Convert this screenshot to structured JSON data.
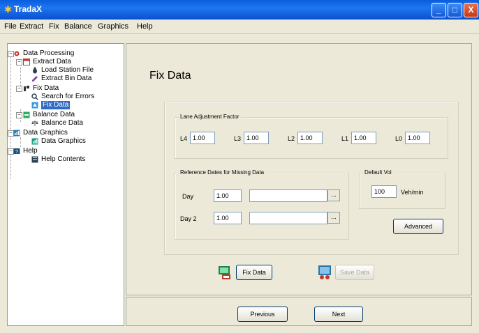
{
  "window": {
    "title": "TradaX",
    "buttons": {
      "minimize": "_",
      "maximize": "□",
      "close": "X"
    }
  },
  "menu": [
    "File",
    "Extract",
    "Fix",
    "Balance",
    "Graphics",
    "Help"
  ],
  "tree": {
    "root": "Data Processing",
    "extract_data": "Extract Data",
    "load_station_file": "Load Station File",
    "extract_bin_data": "Extract Bin Data",
    "fix_data": "Fix Data",
    "search_errors": "Search for Errors",
    "fix_data_child": "Fix Data",
    "balance_data": "Balance Data",
    "balance_data_child": "Balance Data",
    "data_graphics": "Data Graphics",
    "data_graphics_child": "Data Graphics",
    "help": "Help",
    "help_contents": "Help Contents"
  },
  "main": {
    "title": "Fix Data",
    "lane_group": "Lane Adjustment Factor",
    "lanes": [
      {
        "label": "L4",
        "value": "1.00"
      },
      {
        "label": "L3",
        "value": "1.00"
      },
      {
        "label": "L2",
        "value": "1.00"
      },
      {
        "label": "L1",
        "value": "1.00"
      },
      {
        "label": "L0",
        "value": "1.00"
      }
    ],
    "ref_group": "Reference Dates for Missing Data",
    "days": [
      {
        "label": "Day",
        "value": "1.00",
        "date": ""
      },
      {
        "label": "Day 2",
        "value": "1.00",
        "date": ""
      }
    ],
    "browse_label": "...",
    "default_group": "Default Vol",
    "default_value": "100",
    "default_unit": "Veh/min",
    "advanced_label": "Advanced",
    "fix_button": "Fix Data",
    "save_button": "Save Data"
  },
  "footer": {
    "previous": "Previous",
    "next": "Next"
  }
}
